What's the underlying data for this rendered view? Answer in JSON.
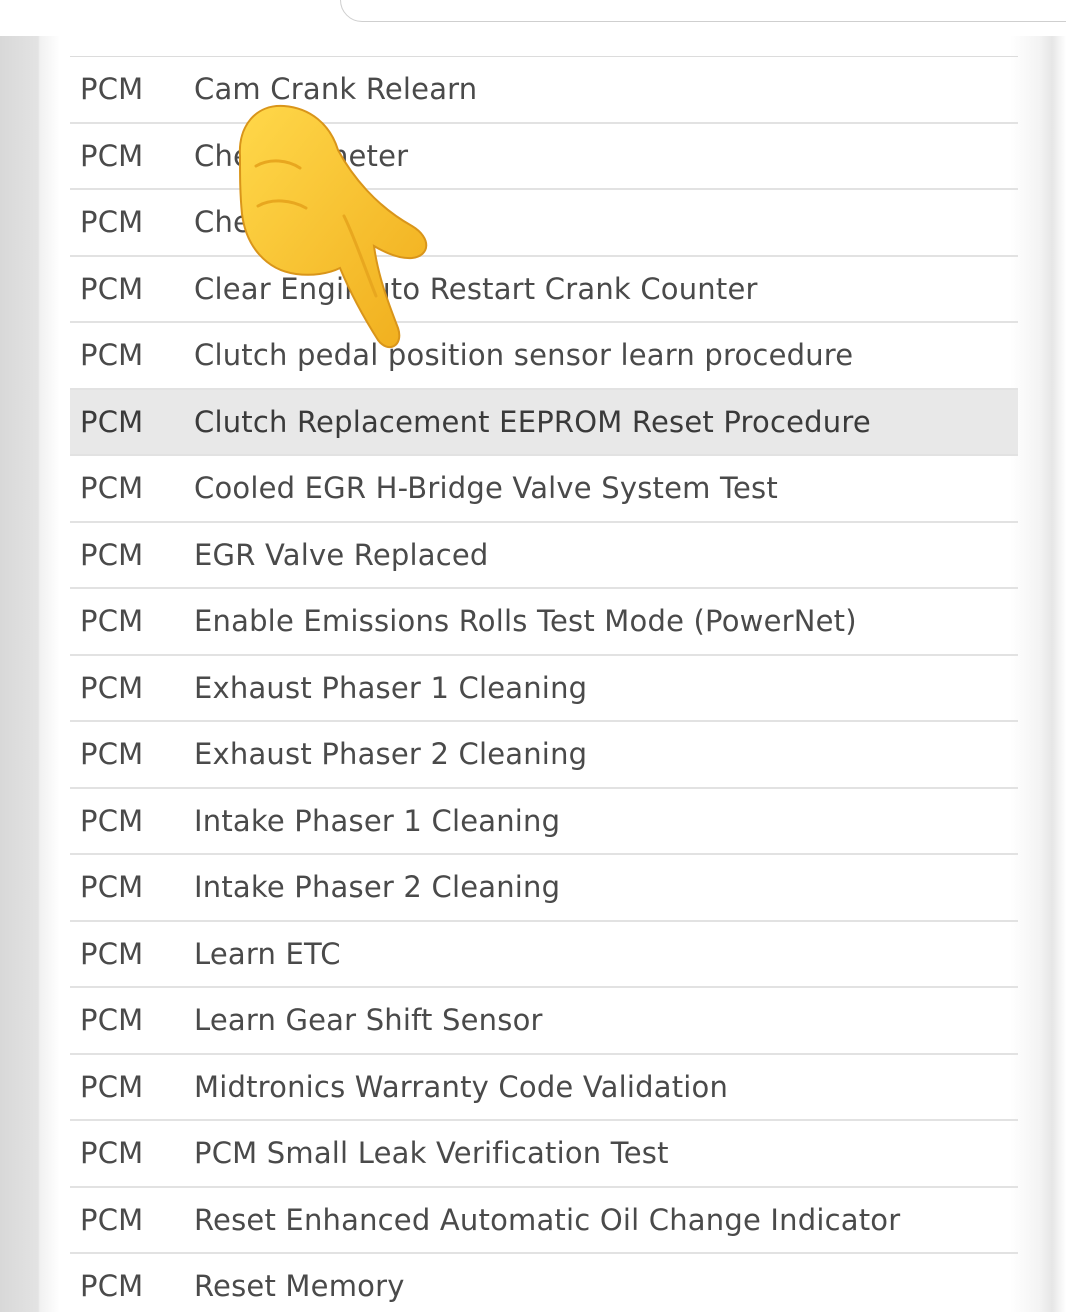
{
  "list": {
    "rows": [
      {
        "module": "PCM",
        "procedure": "Cam Crank Relearn"
      },
      {
        "module": "PCM",
        "procedure": "Che      Odometer"
      },
      {
        "module": "PCM",
        "procedure": "Che"
      },
      {
        "module": "PCM",
        "procedure": "Clear Engin    uto Restart Crank Counter"
      },
      {
        "module": "PCM",
        "procedure": "Clutch pedal position sensor learn procedure"
      },
      {
        "module": "PCM",
        "procedure": "Clutch Replacement EEPROM Reset Procedure"
      },
      {
        "module": "PCM",
        "procedure": "Cooled EGR H-Bridge Valve System Test"
      },
      {
        "module": "PCM",
        "procedure": "EGR Valve Replaced"
      },
      {
        "module": "PCM",
        "procedure": "Enable Emissions Rolls Test Mode (PowerNet)"
      },
      {
        "module": "PCM",
        "procedure": "Exhaust Phaser 1 Cleaning"
      },
      {
        "module": "PCM",
        "procedure": "Exhaust Phaser 2 Cleaning"
      },
      {
        "module": "PCM",
        "procedure": "Intake Phaser 1 Cleaning"
      },
      {
        "module": "PCM",
        "procedure": "Intake Phaser 2 Cleaning"
      },
      {
        "module": "PCM",
        "procedure": "Learn ETC"
      },
      {
        "module": "PCM",
        "procedure": "Learn Gear Shift Sensor"
      },
      {
        "module": "PCM",
        "procedure": "Midtronics Warranty Code Validation"
      },
      {
        "module": "PCM",
        "procedure": "PCM Small Leak Verification Test"
      },
      {
        "module": "PCM",
        "procedure": "Reset Enhanced Automatic Oil Change Indicator"
      },
      {
        "module": "PCM",
        "procedure": "Reset Memory"
      }
    ],
    "selected_index": 5
  },
  "overlay": {
    "icon": "pointing-hand-icon",
    "color": "#f5c22b"
  }
}
